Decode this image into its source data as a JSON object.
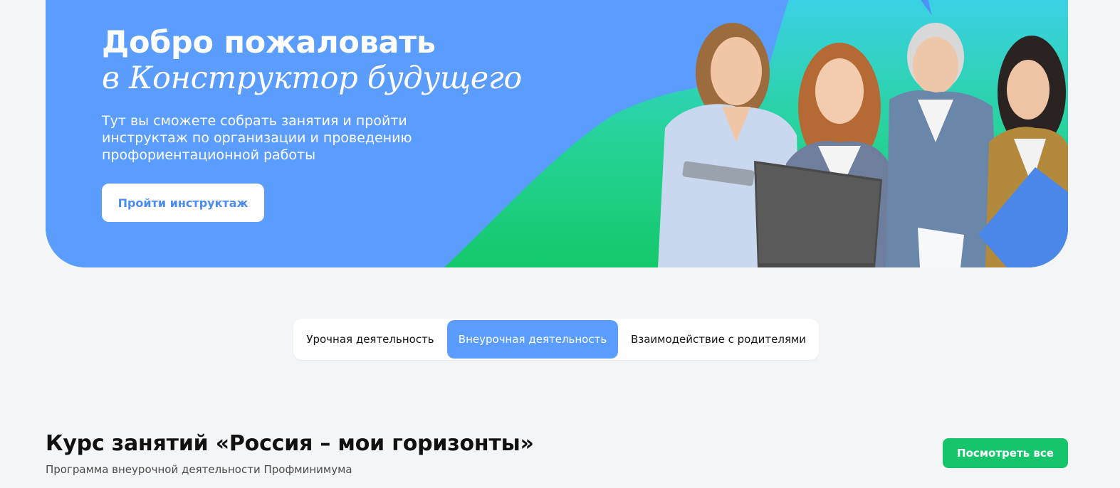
{
  "hero": {
    "title_line1": "Добро пожаловать",
    "title_line2": "в Конструктор будущего",
    "description": "Тут вы сможете собрать занятия и пройти инструктаж по организации и проведению профориентационной работы",
    "button_label": "Пройти инструктаж",
    "colors": {
      "background": "#5b9cff",
      "accent_cyan": "#39cdf5",
      "accent_green": "#15c46b",
      "button_text": "#4a8cf0"
    }
  },
  "tabs": {
    "items": [
      {
        "label": "Урочная деятельность",
        "active": false
      },
      {
        "label": "Внеурочная деятельность",
        "active": true
      },
      {
        "label": "Взаимодействие с родителями",
        "active": false
      }
    ],
    "active_color": "#5b9cff"
  },
  "course": {
    "title": "Курс занятий «Россия – мои горизонты»",
    "subtitle": "Программа внеурочной деятельности Профминимума",
    "view_all_label": "Посмотреть все",
    "view_all_color": "#15c46b"
  }
}
